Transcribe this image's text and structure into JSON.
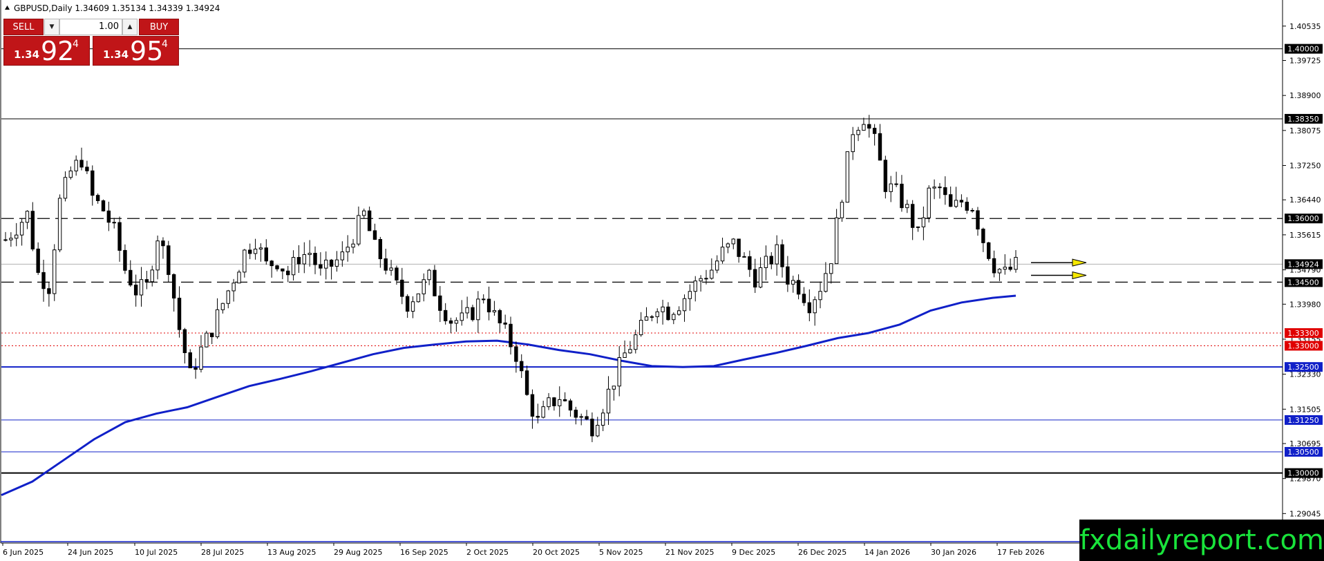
{
  "header": {
    "text": "GBPUSD,Daily  1.34609 1.35134 1.34339 1.34924"
  },
  "trade_panel": {
    "sell_label": "SELL",
    "buy_label": "BUY",
    "lot_value": "1.00",
    "sell_quote": {
      "small": "1.34",
      "big": "92",
      "sup": "4"
    },
    "buy_quote": {
      "small": "1.34",
      "big": "95",
      "sup": "4"
    }
  },
  "brand": "fxdailyreport.com",
  "colors": {
    "background": "#ffffff",
    "candle": "#000000",
    "ma": "#1020c8",
    "support_blue": "#1020c8",
    "support_red": "#e00000",
    "arrow_fill": "#f5e800",
    "trade_red": "#c01518",
    "brand_green": "#19e33b"
  },
  "chart_data": {
    "type": "candlestick",
    "symbol": "GBPUSD",
    "timeframe": "Daily",
    "ylim": [
      1.2835,
      1.4115
    ],
    "y_ticks": [
      1.40535,
      1.39725,
      1.389,
      1.38075,
      1.3725,
      1.3644,
      1.35615,
      1.3479,
      1.3398,
      1.33155,
      1.3233,
      1.31505,
      1.30695,
      1.2987,
      1.29045
    ],
    "x_ticks": [
      "6 Jun 2025",
      "24 Jun 2025",
      "10 Jul 2025",
      "28 Jul 2025",
      "13 Aug 2025",
      "29 Aug 2025",
      "16 Sep 2025",
      "2 Oct 2025",
      "20 Oct 2025",
      "5 Nov 2025",
      "21 Nov 2025",
      "9 Dec 2025",
      "26 Dec 2025",
      "14 Jan 2026",
      "30 Jan 2026",
      "17 Feb 2026"
    ],
    "bars_total": 181,
    "candle_keypoints": [
      [
        0,
        1.355
      ],
      [
        6,
        1.361
      ],
      [
        9,
        1.347
      ],
      [
        12,
        1.344
      ],
      [
        15,
        1.364
      ],
      [
        18,
        1.371
      ],
      [
        21,
        1.374
      ],
      [
        24,
        1.365
      ],
      [
        27,
        1.362
      ],
      [
        30,
        1.357
      ],
      [
        33,
        1.348
      ],
      [
        36,
        1.343
      ],
      [
        39,
        1.344
      ],
      [
        42,
        1.356
      ],
      [
        45,
        1.349
      ],
      [
        48,
        1.334
      ],
      [
        51,
        1.323
      ],
      [
        54,
        1.329
      ],
      [
        57,
        1.334
      ],
      [
        60,
        1.34
      ],
      [
        63,
        1.346
      ],
      [
        66,
        1.352
      ],
      [
        69,
        1.355
      ],
      [
        72,
        1.349
      ],
      [
        75,
        1.35
      ],
      [
        78,
        1.347
      ],
      [
        81,
        1.351
      ],
      [
        84,
        1.352
      ],
      [
        87,
        1.347
      ],
      [
        90,
        1.349
      ],
      [
        93,
        1.351
      ],
      [
        96,
        1.356
      ],
      [
        99,
        1.361
      ],
      [
        102,
        1.353
      ],
      [
        105,
        1.349
      ],
      [
        108,
        1.344
      ],
      [
        111,
        1.34
      ],
      [
        114,
        1.343
      ],
      [
        117,
        1.346
      ],
      [
        120,
        1.34
      ],
      [
        123,
        1.336
      ],
      [
        126,
        1.336
      ],
      [
        129,
        1.338
      ],
      [
        132,
        1.342
      ],
      [
        135,
        1.337
      ],
      [
        138,
        1.333
      ],
      [
        141,
        1.328
      ],
      [
        144,
        1.318
      ],
      [
        147,
        1.312
      ],
      [
        150,
        1.316
      ],
      [
        153,
        1.318
      ],
      [
        156,
        1.315
      ],
      [
        159,
        1.313
      ],
      [
        162,
        1.311
      ],
      [
        165,
        1.316
      ],
      [
        168,
        1.322
      ],
      [
        171,
        1.328
      ],
      [
        174,
        1.332
      ],
      [
        177,
        1.336
      ],
      [
        180,
        1.34
      ],
      [
        183,
        1.338
      ],
      [
        186,
        1.34
      ],
      [
        189,
        1.343
      ],
      [
        192,
        1.346
      ],
      [
        195,
        1.348
      ],
      [
        198,
        1.352
      ],
      [
        201,
        1.354
      ],
      [
        204,
        1.35
      ],
      [
        207,
        1.346
      ],
      [
        210,
        1.349
      ],
      [
        213,
        1.352
      ],
      [
        216,
        1.346
      ],
      [
        219,
        1.344
      ],
      [
        222,
        1.34
      ],
      [
        225,
        1.344
      ],
      [
        228,
        1.351
      ],
      [
        231,
        1.366
      ],
      [
        234,
        1.381
      ],
      [
        237,
        1.384
      ],
      [
        240,
        1.378
      ],
      [
        243,
        1.368
      ],
      [
        246,
        1.366
      ],
      [
        249,
        1.362
      ],
      [
        252,
        1.356
      ],
      [
        255,
        1.366
      ],
      [
        258,
        1.367
      ],
      [
        261,
        1.362
      ],
      [
        264,
        1.364
      ],
      [
        267,
        1.363
      ],
      [
        270,
        1.355
      ],
      [
        273,
        1.349
      ],
      [
        276,
        1.347
      ],
      [
        279,
        1.349
      ]
    ],
    "ma_series": [
      [
        0,
        1.2948
      ],
      [
        8,
        1.298
      ],
      [
        16,
        1.303
      ],
      [
        24,
        1.308
      ],
      [
        32,
        1.312
      ],
      [
        40,
        1.314
      ],
      [
        48,
        1.3155
      ],
      [
        56,
        1.318
      ],
      [
        64,
        1.3205
      ],
      [
        72,
        1.3222
      ],
      [
        80,
        1.324
      ],
      [
        88,
        1.326
      ],
      [
        96,
        1.328
      ],
      [
        104,
        1.3295
      ],
      [
        112,
        1.3303
      ],
      [
        120,
        1.331
      ],
      [
        128,
        1.3312
      ],
      [
        136,
        1.3303
      ],
      [
        144,
        1.329
      ],
      [
        152,
        1.328
      ],
      [
        160,
        1.3265
      ],
      [
        168,
        1.3252
      ],
      [
        176,
        1.325
      ],
      [
        184,
        1.3252
      ],
      [
        192,
        1.3268
      ],
      [
        200,
        1.3283
      ],
      [
        208,
        1.33
      ],
      [
        216,
        1.3318
      ],
      [
        224,
        1.333
      ],
      [
        232,
        1.335
      ],
      [
        240,
        1.3383
      ],
      [
        248,
        1.3402
      ],
      [
        256,
        1.3413
      ],
      [
        262,
        1.3418
      ]
    ],
    "horizontal_lines": [
      {
        "value": 1.4,
        "label": "1.40000",
        "style": "solid",
        "color": "#000000",
        "label_bg": "#000000"
      },
      {
        "value": 1.3835,
        "label": "1.38350",
        "style": "solid",
        "color": "#000000",
        "label_bg": "#000000"
      },
      {
        "value": 1.36,
        "label": "1.36000",
        "style": "dashed",
        "color": "#000000",
        "label_bg": "#000000"
      },
      {
        "value": 1.34924,
        "label": "1.34924",
        "style": "solid",
        "color": "#b0b0b0",
        "label_bg": "#000000"
      },
      {
        "value": 1.345,
        "label": "1.34500",
        "style": "dashed",
        "color": "#000000",
        "label_bg": "#000000"
      },
      {
        "value": 1.333,
        "label": "1.33300",
        "style": "dotted",
        "color": "#e00000",
        "label_bg": "#e00000"
      },
      {
        "value": 1.33,
        "label": "1.33000",
        "style": "dotted",
        "color": "#e00000",
        "label_bg": "#e00000"
      },
      {
        "value": 1.325,
        "label": "1.32500",
        "style": "solid-thick",
        "color": "#1020c8",
        "label_bg": "#1020c8"
      },
      {
        "value": 1.3125,
        "label": "1.31250",
        "style": "solid",
        "color": "#1020c8",
        "label_bg": "#1020c8"
      },
      {
        "value": 1.305,
        "label": "1.30500",
        "style": "solid",
        "color": "#1020c8",
        "label_bg": "#1020c8"
      },
      {
        "value": 1.3,
        "label": "1.30000",
        "style": "solid-thick",
        "color": "#000000",
        "label_bg": "#000000"
      }
    ],
    "arrows": [
      {
        "value": 1.3496
      },
      {
        "value": 1.3466
      }
    ]
  }
}
